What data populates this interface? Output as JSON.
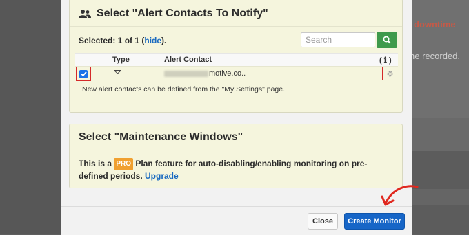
{
  "background": {
    "right_red_text": "downtime",
    "right_grey_text": "ne recorded."
  },
  "alert_panel": {
    "title": "Select \"Alert Contacts To Notify\"",
    "selected_prefix": "Selected: 1 of 1 (",
    "hide_link": "hide",
    "selected_suffix": ").",
    "search_placeholder": "Search",
    "columns": {
      "type": "Type",
      "contact": "Alert Contact",
      "info": "( ℹ )"
    },
    "row": {
      "checked": true,
      "type_icon": "envelope-icon",
      "email_visible": "motive.co..",
      "action_icon": "gear-icon"
    },
    "hint": "New alert contacts can be defined from the \"My Settings\" page."
  },
  "maintenance_panel": {
    "title": "Select \"Maintenance Windows\"",
    "text_before": "This is a ",
    "badge": "PRO",
    "text_after": " Plan feature for auto-disabling/enabling monitoring on pre-defined periods. ",
    "upgrade_link": "Upgrade"
  },
  "footer": {
    "close_label": "Close",
    "create_label": "Create Monitor"
  },
  "colors": {
    "accent_blue": "#1766c7",
    "search_green": "#3f9a4c",
    "highlight_red": "#d42a2a",
    "panel_bg": "#f5f5dd",
    "pro_orange": "#f0a030"
  }
}
